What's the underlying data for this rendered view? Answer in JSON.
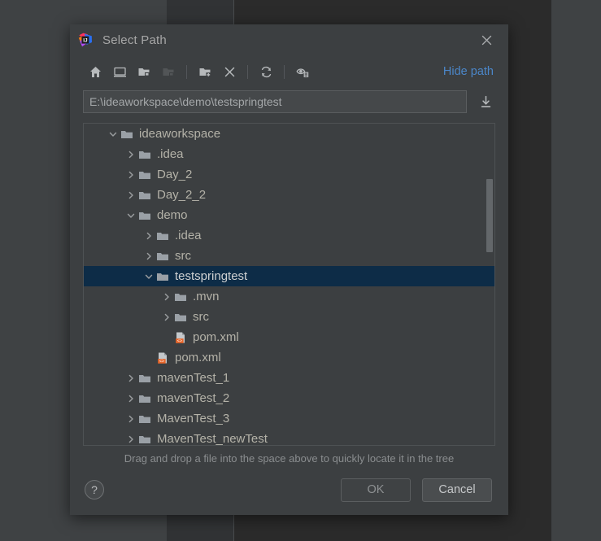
{
  "dialog": {
    "title": "Select Path",
    "logo_icon": "intellij-idea-logo",
    "close_icon": "close-icon"
  },
  "toolbar": {
    "buttons": [
      {
        "name": "home-icon",
        "tooltip": "Home",
        "enabled": true
      },
      {
        "name": "desktop-icon",
        "tooltip": "Desktop",
        "enabled": true
      },
      {
        "name": "expand-folder-icon",
        "tooltip": "Expand",
        "enabled": true
      },
      {
        "name": "collapse-folder-icon",
        "tooltip": "Collapse",
        "enabled": false
      },
      {
        "name": "new-folder-icon",
        "tooltip": "New Folder",
        "enabled": true
      },
      {
        "name": "delete-icon",
        "tooltip": "Delete",
        "enabled": true
      },
      {
        "name": "refresh-icon",
        "tooltip": "Refresh",
        "enabled": true
      },
      {
        "name": "show-hidden-files-icon",
        "tooltip": "Show Hidden Files",
        "enabled": true
      }
    ],
    "hide_path_label": "Hide path"
  },
  "path": {
    "value": "E:\\ideaworkspace\\demo\\testspringtest",
    "placeholder": "",
    "import_icon": "import-path-icon"
  },
  "tree": {
    "rows": [
      {
        "label": "ideaworkspace",
        "indent": 1,
        "icon": "folder-icon",
        "chevron": "down",
        "selected": false
      },
      {
        "label": ".idea",
        "indent": 2,
        "icon": "folder-icon",
        "chevron": "right",
        "selected": false
      },
      {
        "label": "Day_2",
        "indent": 2,
        "icon": "folder-icon",
        "chevron": "right",
        "selected": false
      },
      {
        "label": "Day_2_2",
        "indent": 2,
        "icon": "folder-icon",
        "chevron": "right",
        "selected": false
      },
      {
        "label": "demo",
        "indent": 2,
        "icon": "folder-icon",
        "chevron": "down",
        "selected": false
      },
      {
        "label": ".idea",
        "indent": 3,
        "icon": "folder-icon",
        "chevron": "right",
        "selected": false
      },
      {
        "label": "src",
        "indent": 3,
        "icon": "folder-icon",
        "chevron": "right",
        "selected": false
      },
      {
        "label": "testspringtest",
        "indent": 3,
        "icon": "folder-icon",
        "chevron": "down",
        "selected": true
      },
      {
        "label": ".mvn",
        "indent": 4,
        "icon": "folder-icon",
        "chevron": "right",
        "selected": false
      },
      {
        "label": "src",
        "indent": 4,
        "icon": "folder-icon",
        "chevron": "right",
        "selected": false
      },
      {
        "label": "pom.xml",
        "indent": 4,
        "icon": "xml-file-icon",
        "chevron": "none",
        "selected": false
      },
      {
        "label": "pom.xml",
        "indent": 3,
        "icon": "xml-file-icon",
        "chevron": "none",
        "selected": false
      },
      {
        "label": "mavenTest_1",
        "indent": 2,
        "icon": "folder-icon",
        "chevron": "right",
        "selected": false
      },
      {
        "label": "mavenTest_2",
        "indent": 2,
        "icon": "folder-icon",
        "chevron": "right",
        "selected": false
      },
      {
        "label": "MavenTest_3",
        "indent": 2,
        "icon": "folder-icon",
        "chevron": "right",
        "selected": false
      },
      {
        "label": "MavenTest_newTest",
        "indent": 2,
        "icon": "folder-icon",
        "chevron": "right",
        "selected": false
      }
    ],
    "scrollbar": {
      "thumb_top_pct": 17,
      "thumb_height_pct": 23
    }
  },
  "hint": "Drag and drop a file into the space above to quickly locate it in the tree",
  "footer": {
    "help_label": "?",
    "ok_label": "OK",
    "cancel_label": "Cancel"
  },
  "colors": {
    "dialog_bg": "#3c3f41",
    "selection": "#0d2c47",
    "link": "#4b86c8",
    "text": "#b4b2a8",
    "xml_badge": "#e8662a"
  }
}
